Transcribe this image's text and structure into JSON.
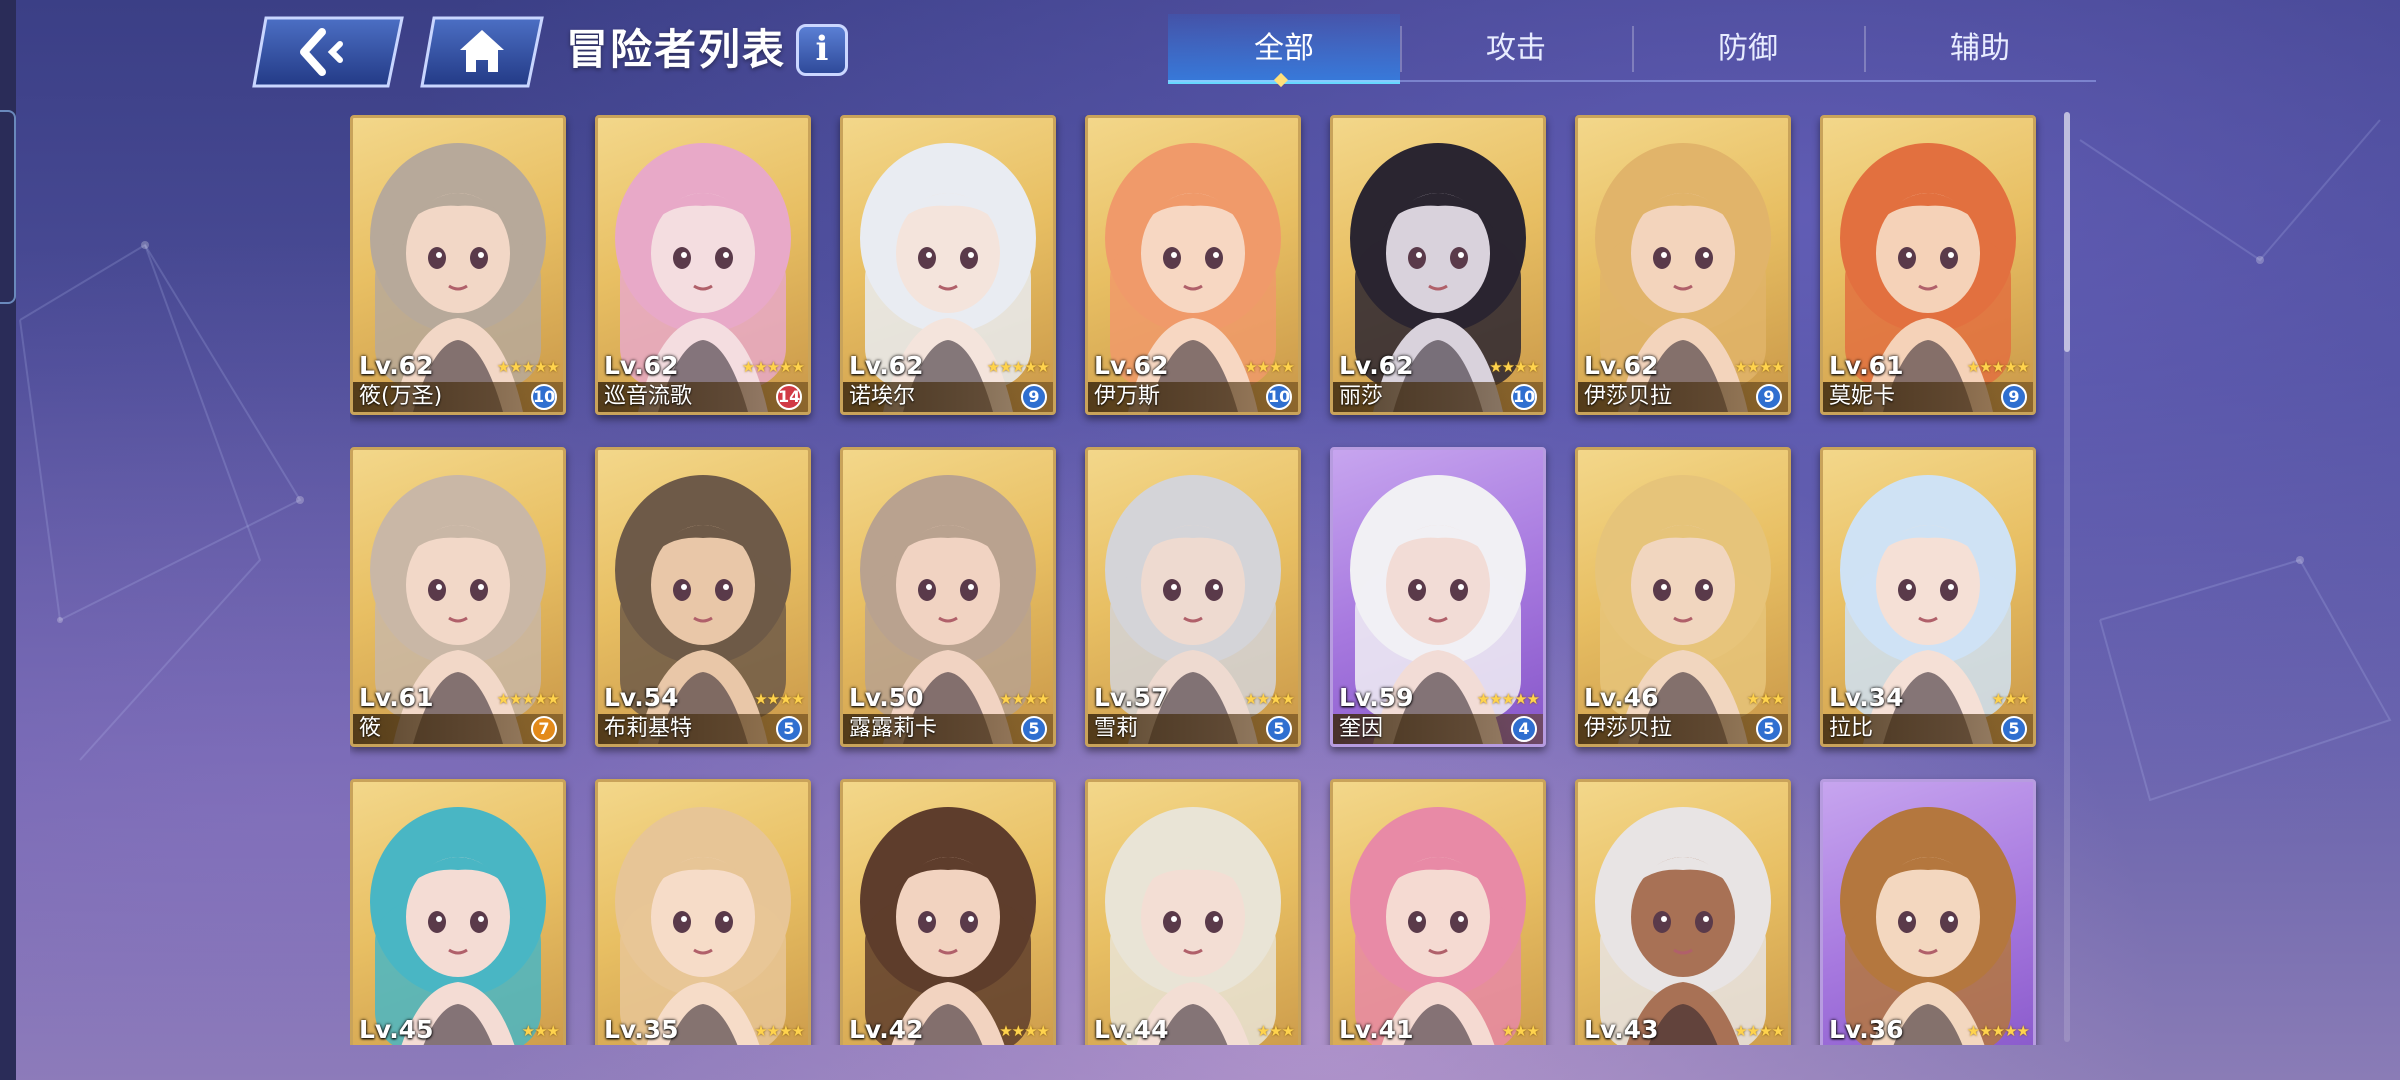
{
  "header": {
    "title": "冒险者列表",
    "info_label": "i"
  },
  "tabs": [
    {
      "label": "全部",
      "active": true
    },
    {
      "label": "攻击",
      "active": false
    },
    {
      "label": "防御",
      "active": false
    },
    {
      "label": "辅助",
      "active": false
    }
  ],
  "cards": [
    {
      "level": "Lv.62",
      "stars": 5,
      "name": "筱(万圣)",
      "badge": "10",
      "badge_color": "blue",
      "frame": "gold",
      "hair": "#b7a99a",
      "skin": "#f2d7c6"
    },
    {
      "level": "Lv.62",
      "stars": 5,
      "name": "巡音流歌",
      "badge": "14",
      "badge_color": "red",
      "frame": "gold",
      "hair": "#e8a9c8",
      "skin": "#f4dde0"
    },
    {
      "level": "Lv.62",
      "stars": 5,
      "name": "诺埃尔",
      "badge": "9",
      "badge_color": "blue",
      "frame": "gold",
      "hair": "#e9ecf2",
      "skin": "#f4e4dc"
    },
    {
      "level": "Lv.62",
      "stars": 4,
      "name": "伊万斯",
      "badge": "10",
      "badge_color": "blue",
      "frame": "gold",
      "hair": "#f09a6a",
      "skin": "#f7d7c2"
    },
    {
      "level": "Lv.62",
      "stars": 4,
      "name": "丽莎",
      "badge": "10",
      "badge_color": "blue",
      "frame": "gold",
      "hair": "#2a2530",
      "skin": "#d9d2dc"
    },
    {
      "level": "Lv.62",
      "stars": 4,
      "name": "伊莎贝拉",
      "badge": "9",
      "badge_color": "blue",
      "frame": "gold",
      "hair": "#e1b46a",
      "skin": "#f3d4bc"
    },
    {
      "level": "Lv.61",
      "stars": 5,
      "name": "莫妮卡",
      "badge": "9",
      "badge_color": "blue",
      "frame": "gold",
      "hair": "#e2703f",
      "skin": "#f5d2b8"
    },
    {
      "level": "Lv.61",
      "stars": 5,
      "name": "筱",
      "badge": "7",
      "badge_color": "orange",
      "frame": "gold",
      "hair": "#c9b7a6",
      "skin": "#f2d8c8"
    },
    {
      "level": "Lv.54",
      "stars": 4,
      "name": "布莉基特",
      "badge": "5",
      "badge_color": "blue",
      "frame": "gold",
      "hair": "#6e5a48",
      "skin": "#e9c7a8"
    },
    {
      "level": "Lv.50",
      "stars": 4,
      "name": "露露莉卡",
      "badge": "5",
      "badge_color": "blue",
      "frame": "gold",
      "hair": "#b9a28f",
      "skin": "#f1d3c2"
    },
    {
      "level": "Lv.57",
      "stars": 4,
      "name": "雪莉",
      "badge": "5",
      "badge_color": "blue",
      "frame": "gold",
      "hair": "#d4d4d8",
      "skin": "#eedad0"
    },
    {
      "level": "Lv.59",
      "stars": 5,
      "name": "奎因",
      "badge": "4",
      "badge_color": "blue",
      "frame": "purple",
      "hair": "#f1f0f4",
      "skin": "#f2dcd6"
    },
    {
      "level": "Lv.46",
      "stars": 3,
      "name": "伊莎贝拉",
      "badge": "5",
      "badge_color": "blue",
      "frame": "gold",
      "hair": "#e6c47a",
      "skin": "#f1d6bf"
    },
    {
      "level": "Lv.34",
      "stars": 3,
      "name": "拉比",
      "badge": "5",
      "badge_color": "blue",
      "frame": "gold",
      "hair": "#cfe2f4",
      "skin": "#f5e0d6"
    },
    {
      "level": "Lv.45",
      "stars": 3,
      "frame": "gold",
      "hair": "#49b6c4",
      "skin": "#f4dcd4"
    },
    {
      "level": "Lv.35",
      "stars": 4,
      "frame": "gold",
      "hair": "#e7c596",
      "skin": "#f6dcc8"
    },
    {
      "level": "Lv.42",
      "stars": 4,
      "frame": "gold",
      "hair": "#5e3d2c",
      "skin": "#f2d3c0"
    },
    {
      "level": "Lv.44",
      "stars": 3,
      "frame": "gold",
      "hair": "#e9e4d6",
      "skin": "#f3ded4"
    },
    {
      "level": "Lv.41",
      "stars": 3,
      "frame": "gold",
      "hair": "#e88aa6",
      "skin": "#f5dad2"
    },
    {
      "level": "Lv.43",
      "stars": 4,
      "frame": "gold",
      "hair": "#e8e4e4",
      "skin": "#a87155"
    },
    {
      "level": "Lv.36",
      "stars": 5,
      "frame": "purple",
      "hair": "#b4773e",
      "skin": "#f3d7bf"
    }
  ],
  "colors": {
    "badge_blue": "#2f6fd0",
    "badge_red": "#d13a45",
    "badge_orange": "#e38a1a",
    "tab_active": "#3b86e0",
    "star": "#ffd34d"
  }
}
